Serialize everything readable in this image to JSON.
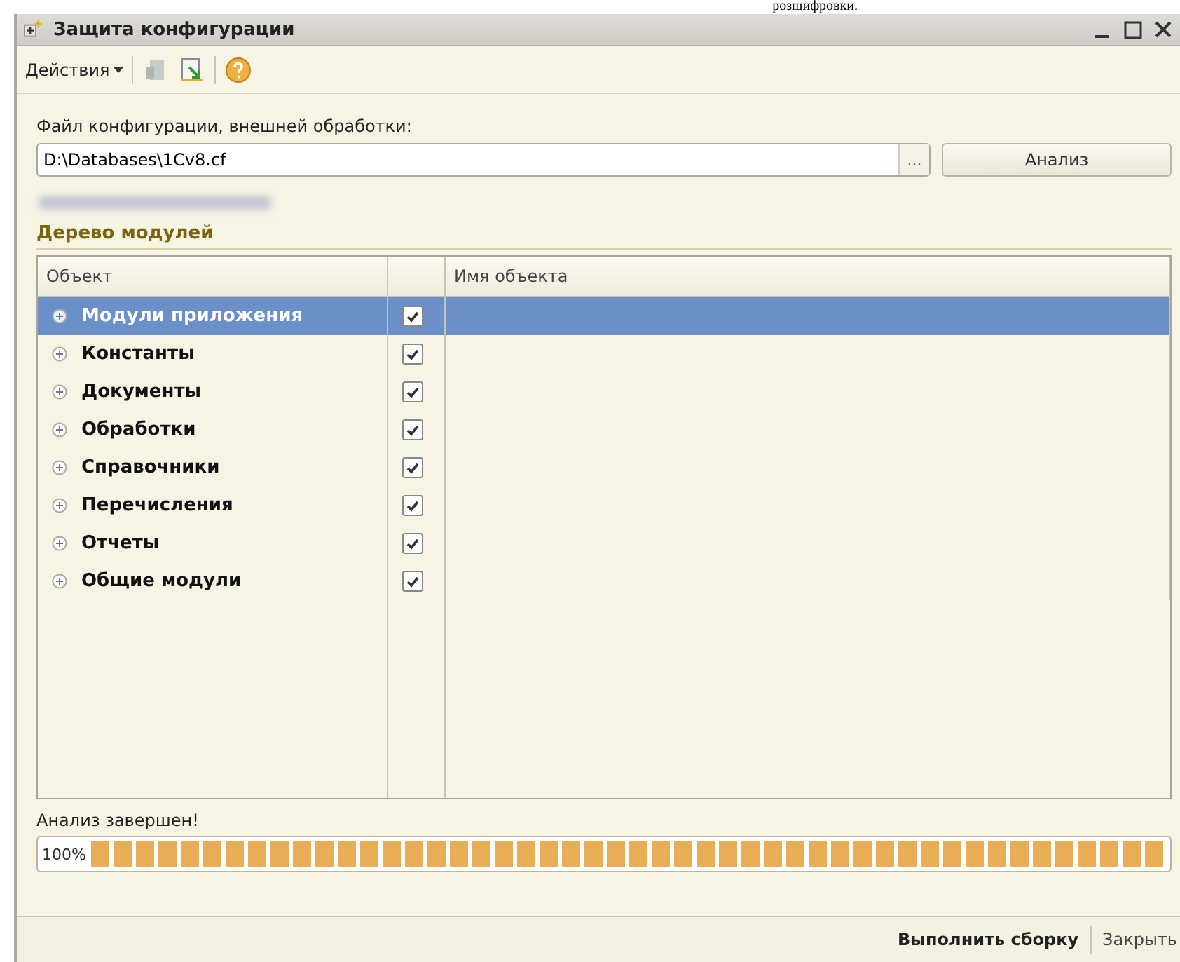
{
  "backdrop_text": "розшифровки.",
  "window": {
    "title": "Защита конфигурации"
  },
  "toolbar": {
    "actions_menu": "Действия"
  },
  "file_field": {
    "label": "Файл конфигурации, внешней обработки:",
    "value": "D:\\Databases\\1Cv8.cf",
    "browse": "...",
    "analyze_button": "Анализ"
  },
  "section_title": "Дерево модулей",
  "table": {
    "columns": [
      "Объект",
      "Имя объекта"
    ],
    "rows": [
      {
        "object": "Модули приложения",
        "checked": true,
        "selected": true,
        "expanded": false
      },
      {
        "object": "Константы",
        "checked": true,
        "selected": false,
        "expanded": false
      },
      {
        "object": "Документы",
        "checked": true,
        "selected": false,
        "expanded": false
      },
      {
        "object": "Обработки",
        "checked": true,
        "selected": false,
        "expanded": false
      },
      {
        "object": "Справочники",
        "checked": true,
        "selected": false,
        "expanded": false
      },
      {
        "object": "Перечисления",
        "checked": true,
        "selected": false,
        "expanded": false
      },
      {
        "object": "Отчеты",
        "checked": true,
        "selected": false,
        "expanded": false
      },
      {
        "object": "Общие модули",
        "checked": true,
        "selected": false,
        "expanded": false
      }
    ]
  },
  "status": "Анализ завершен!",
  "progress": {
    "level": 1,
    "reading": "100%"
  },
  "footer_buttons": [
    {
      "label": "Выполнить сборку",
      "kind": "primary"
    },
    {
      "label": "Закрыть",
      "kind": "plain"
    }
  ]
}
